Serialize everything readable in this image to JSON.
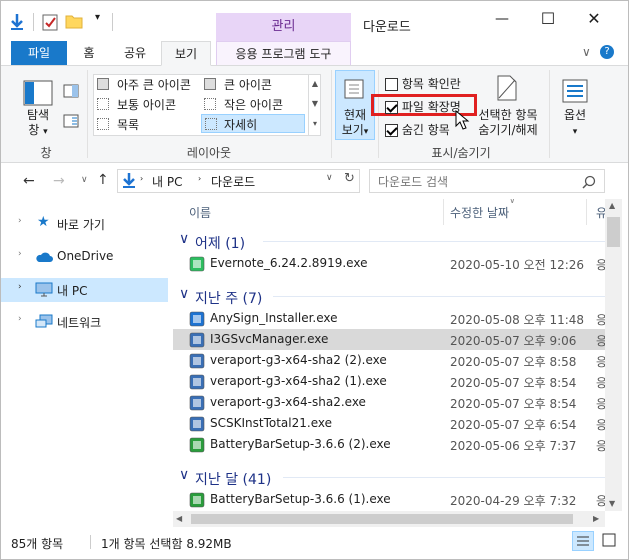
{
  "window": {
    "title": "다운로드",
    "manage_tab": "관리",
    "minimize": "—",
    "maximize": "☐",
    "close": "✕",
    "help": "?"
  },
  "tabs": [
    "파일",
    "홈",
    "공유",
    "보기",
    "응용 프로그램 도구"
  ],
  "ribbon": {
    "pane_group": {
      "nav_pane_label1": "탐색",
      "nav_pane_label2": "창",
      "label": "창"
    },
    "layout_group": {
      "items": [
        "아주 큰 아이콘",
        "큰 아이콘",
        "보통 아이콘",
        "작은 아이콘",
        "목록",
        "자세히"
      ],
      "label": "레이아웃"
    },
    "current_view": {
      "label1": "현재",
      "label2": "보기"
    },
    "show_hide": {
      "item_checkbox": "항목 확인란",
      "file_ext": "파일 확장명",
      "hidden_items": "숨긴 항목",
      "hide_selected1": "선택한 항목",
      "hide_selected2": "숨기기/해제",
      "label": "표시/숨기기"
    },
    "options": {
      "label": "옵션"
    }
  },
  "address": {
    "path": [
      "내 PC",
      "다운로드"
    ],
    "search_placeholder": "다운로드 검색"
  },
  "nav": [
    {
      "label": "바로 가기"
    },
    {
      "label": "OneDrive"
    },
    {
      "label": "내 PC"
    },
    {
      "label": "네트워크"
    }
  ],
  "columns": {
    "name": "이름",
    "date": "수정한 날짜",
    "type": "유"
  },
  "groups": [
    {
      "name": "어제 (1)",
      "files": [
        {
          "name": "Evernote_6.24.2.8919.exe",
          "date": "2020-05-10 오전 12:26",
          "type": "응"
        }
      ]
    },
    {
      "name": "지난 주 (7)",
      "files": [
        {
          "name": "AnySign_Installer.exe",
          "date": "2020-05-08 오후 11:48",
          "type": "응"
        },
        {
          "name": "I3GSvcManager.exe",
          "date": "2020-05-07 오후 9:06",
          "type": "응"
        },
        {
          "name": "veraport-g3-x64-sha2 (2).exe",
          "date": "2020-05-07 오후 8:58",
          "type": "응"
        },
        {
          "name": "veraport-g3-x64-sha2 (1).exe",
          "date": "2020-05-07 오후 8:54",
          "type": "응"
        },
        {
          "name": "veraport-g3-x64-sha2.exe",
          "date": "2020-05-07 오후 8:54",
          "type": "응"
        },
        {
          "name": "SCSKInstTotal21.exe",
          "date": "2020-05-07 오후 6:54",
          "type": "응"
        },
        {
          "name": "BatteryBarSetup-3.6.6 (2).exe",
          "date": "2020-05-06 오후 7:37",
          "type": "응"
        }
      ]
    },
    {
      "name": "지난 달 (41)",
      "files": [
        {
          "name": "BatteryBarSetup-3.6.6 (1).exe",
          "date": "2020-04-29 오후 7:32",
          "type": "응"
        }
      ]
    }
  ],
  "status": {
    "count": "85개 항목",
    "selected": "1개 항목 선택함 8.92MB"
  }
}
